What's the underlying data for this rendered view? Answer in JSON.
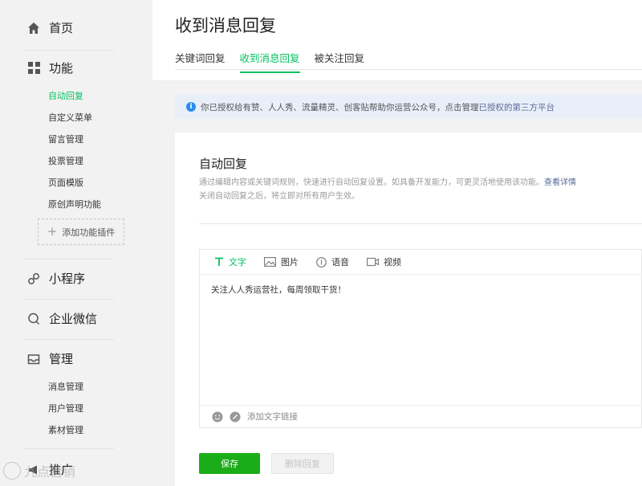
{
  "sidebar": {
    "home": {
      "label": "首页",
      "icon": "home-icon"
    },
    "features": {
      "label": "功能",
      "icon": "grid-icon",
      "items": [
        "自动回复",
        "自定义菜单",
        "留言管理",
        "投票管理",
        "页面模版",
        "原创声明功能"
      ],
      "active_item": "自动回复",
      "add_plugin_label": "添加功能插件"
    },
    "miniprogram": {
      "label": "小程序",
      "icon": "link-icon"
    },
    "work_wechat": {
      "label": "企业微信",
      "icon": "chat-icon"
    },
    "management": {
      "label": "管理",
      "icon": "inbox-icon",
      "items": [
        "消息管理",
        "用户管理",
        "素材管理"
      ]
    },
    "promotion": {
      "label": "推广",
      "icon": "megaphone-icon"
    }
  },
  "header": {
    "title": "收到消息回复",
    "tabs": [
      "关键词回复",
      "收到消息回复",
      "被关注回复"
    ],
    "active_tab": "收到消息回复"
  },
  "notice": {
    "text": "你已授权给有赞、人人秀、流量精灵、创客贴帮助你运营公众号，点击管理",
    "link": "已授权的第三方平台"
  },
  "auto_reply": {
    "title": "自动回复",
    "desc_line1": "通过编辑内容或关键词规则，快速进行自动回复设置。如具备开发能力，可更灵活地使用该功能。",
    "desc_link": "查看详情",
    "desc_line2": "关闭自动回复之后，将立即对所有用户生效。"
  },
  "editor": {
    "tabs": [
      {
        "label": "文字",
        "icon": "text-icon"
      },
      {
        "label": "图片",
        "icon": "image-icon"
      },
      {
        "label": "语音",
        "icon": "audio-icon"
      },
      {
        "label": "视频",
        "icon": "video-icon"
      }
    ],
    "active_tab": "文字",
    "content": "关注人人秀运营社，每周领取干货！",
    "add_link_label": "添加文字链接"
  },
  "buttons": {
    "save": "保存",
    "delete": "删除回复"
  },
  "watermark": {
    "text": "九点营销"
  },
  "colors": {
    "accent": "#07c160",
    "save_button": "#1aad19",
    "link": "#576b95",
    "info": "#2d8cf0"
  }
}
